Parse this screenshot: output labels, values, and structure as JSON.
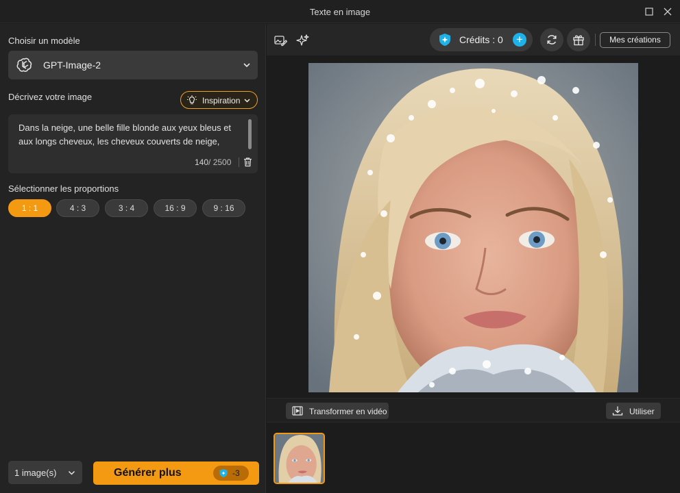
{
  "window": {
    "title": "Texte en image"
  },
  "left_panel": {
    "model_label": "Choisir un modèle",
    "model_name": "GPT-Image-2",
    "describe_label": "Décrivez votre image",
    "inspiration_label": "Inspiration",
    "prompt_text": "Dans la neige, une belle fille blonde aux yeux bleus et aux longs cheveux, les cheveux couverts de neige,",
    "char_count": "140",
    "char_max": "/ 2500",
    "ratio_label": "Sélectionner les proportions",
    "ratios": [
      "1 : 1",
      "4 : 3",
      "3 : 4",
      "16 : 9",
      "9 : 16"
    ],
    "selected_ratio": "1 : 1",
    "image_count": "1 image(s)",
    "generate_label": "Générer plus",
    "generate_cost": "-3"
  },
  "toolbar": {
    "credits_text": "Crédits : 0",
    "my_creations_label": "Mes créations"
  },
  "preview": {
    "transform_video_label": "Transformer en vidéo",
    "use_label": "Utiliser"
  },
  "colors": {
    "accent": "#f39a12",
    "credit_blue": "#1fb2e8",
    "panel_bg": "#232323"
  },
  "icons": [
    "window-maximize-icon",
    "close-icon",
    "openai-logo-icon",
    "chevron-down-icon",
    "lightbulb-icon",
    "trash-icon",
    "image-edit-icon",
    "sparkle-icon",
    "credit-shield-icon",
    "plus-icon",
    "refresh-icon",
    "gift-icon",
    "video-icon",
    "download-icon"
  ]
}
